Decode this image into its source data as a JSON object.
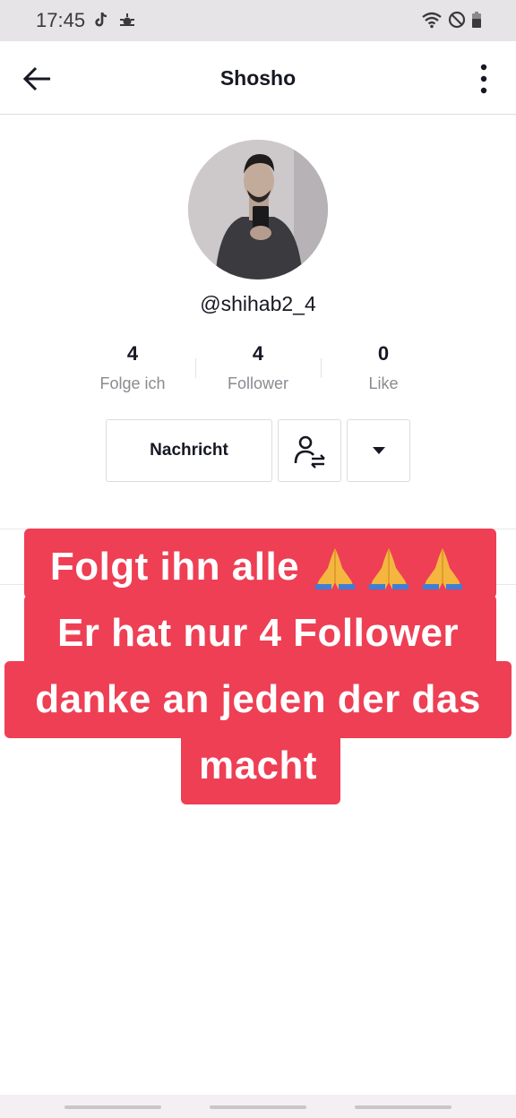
{
  "status_bar": {
    "time": "17:45",
    "left_icons": [
      "tiktok-icon",
      "weather-icon"
    ],
    "right_icons": [
      "wifi-icon",
      "do-not-disturb-icon",
      "battery-icon"
    ]
  },
  "header": {
    "title": "Shosho",
    "back_icon": "back-arrow-icon",
    "more_icon": "more-vertical-icon"
  },
  "profile": {
    "username": "@shihab2_4"
  },
  "stats": [
    {
      "value": "4",
      "label": "Folge ich"
    },
    {
      "value": "4",
      "label": "Follower"
    },
    {
      "value": "0",
      "label": "Like"
    }
  ],
  "actions": {
    "message_label": "Nachricht",
    "follow_icon": "user-swap-icon",
    "more_icon": "caret-down-icon"
  },
  "caption": {
    "lines": [
      "Folgt ihn alle",
      "Er hat nur 4 Follower",
      "danke an jeden der das",
      "macht"
    ],
    "emoji_icons": [
      "praying-hands-icon",
      "praying-hands-icon",
      "praying-hands-icon"
    ],
    "background_color": "#ee3f54"
  }
}
